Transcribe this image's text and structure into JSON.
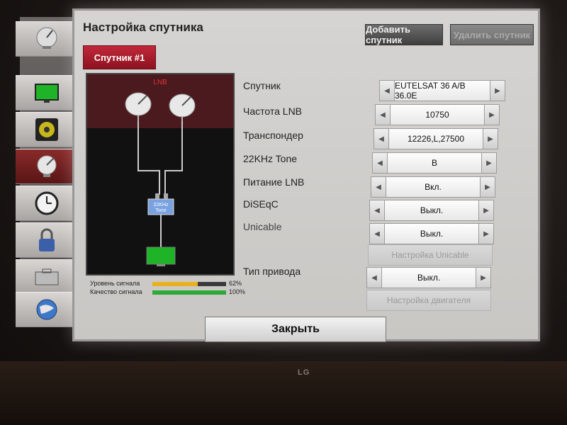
{
  "dialog": {
    "title": "Настройка спутника",
    "add_button": "Добавить спутник",
    "delete_button": "Удалить спутник",
    "tab_label": "Спутник #1",
    "close_button": "Закрыть"
  },
  "diagram": {
    "lnb_label": "LNB",
    "tone_label_1": "22KHz",
    "tone_label_2": "Tone"
  },
  "signal": {
    "level_label": "Уровень сигнала",
    "level_value": "62%",
    "level_fraction": 0.62,
    "level_color": "#e8b21f",
    "quality_label": "Качество сигнала",
    "quality_value": "100%",
    "quality_fraction": 1.0,
    "quality_color": "#2fa83a"
  },
  "settings": [
    {
      "label": "Спутник",
      "value": "EUTELSAT 36 A/B 36.0E"
    },
    {
      "label": "Частота LNB",
      "value": "10750"
    },
    {
      "label": "Транспондер",
      "value": "12226,L,27500"
    },
    {
      "label": "22KHz Tone",
      "value": "В"
    },
    {
      "label": "Питание LNB",
      "value": "Вкл."
    },
    {
      "label": "DiSEqC",
      "value": "Выкл."
    },
    {
      "label": "Unicable",
      "value": "Выкл."
    }
  ],
  "unicable_settings_button": "Настройка Unicable",
  "motor": {
    "label": "Тип привода",
    "value": "Выкл.",
    "settings_button": "Настройка двигателя"
  },
  "brand": "LG",
  "sidebar_icons": [
    "satellite-icon",
    "tv-screen-icon",
    "speaker-icon",
    "satellite-dish-icon",
    "clock-icon",
    "lock-icon",
    "toolbox-icon",
    "globe-icon"
  ]
}
